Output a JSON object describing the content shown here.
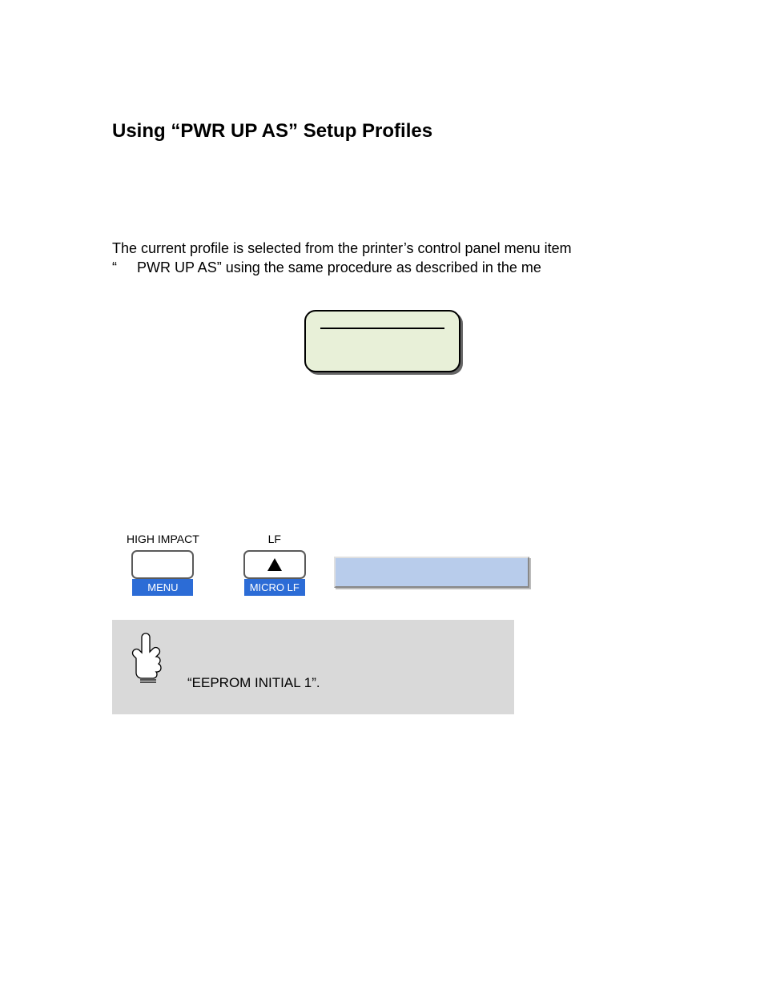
{
  "heading": "Using “PWR UP AS” Setup Profiles",
  "paragraph_line1": "The current profile is selected from the printer’s control panel menu item",
  "paragraph_line2": "“     PWR UP AS” using the same procedure as described in the me",
  "keys": {
    "left_top": "HIGH IMPACT",
    "left_bottom": "MENU",
    "mid_top": "LF",
    "mid_bottom": "MICRO LF"
  },
  "note_text": "“EEPROM INITIAL 1”."
}
